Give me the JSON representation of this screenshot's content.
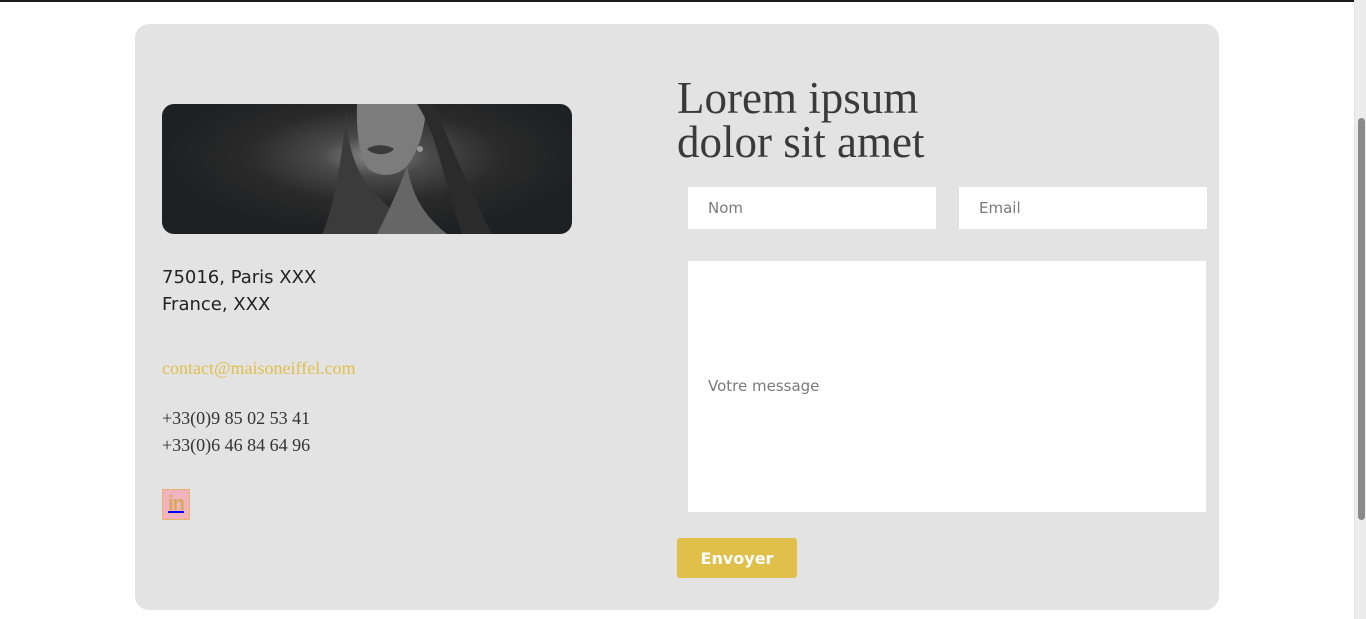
{
  "contact": {
    "address_line1": "75016, Paris XXX",
    "address_line2": "France, XXX",
    "email": "contact@maisoneiffel.com",
    "phone1": "+33(0)9 85 02 53 41",
    "phone2": "+33(0)6 46 84 64 96",
    "linkedin_icon": "linkedin-icon",
    "linkedin_label": "in"
  },
  "form": {
    "heading_line1": "Lorem ipsum",
    "heading_line2": "dolor sit amet",
    "name_placeholder": "Nom",
    "email_placeholder": "Email",
    "message_placeholder": "Votre message",
    "submit_label": "Envoyer"
  },
  "colors": {
    "accent": "#e0bf4b",
    "card_background": "#e3e3e3"
  }
}
